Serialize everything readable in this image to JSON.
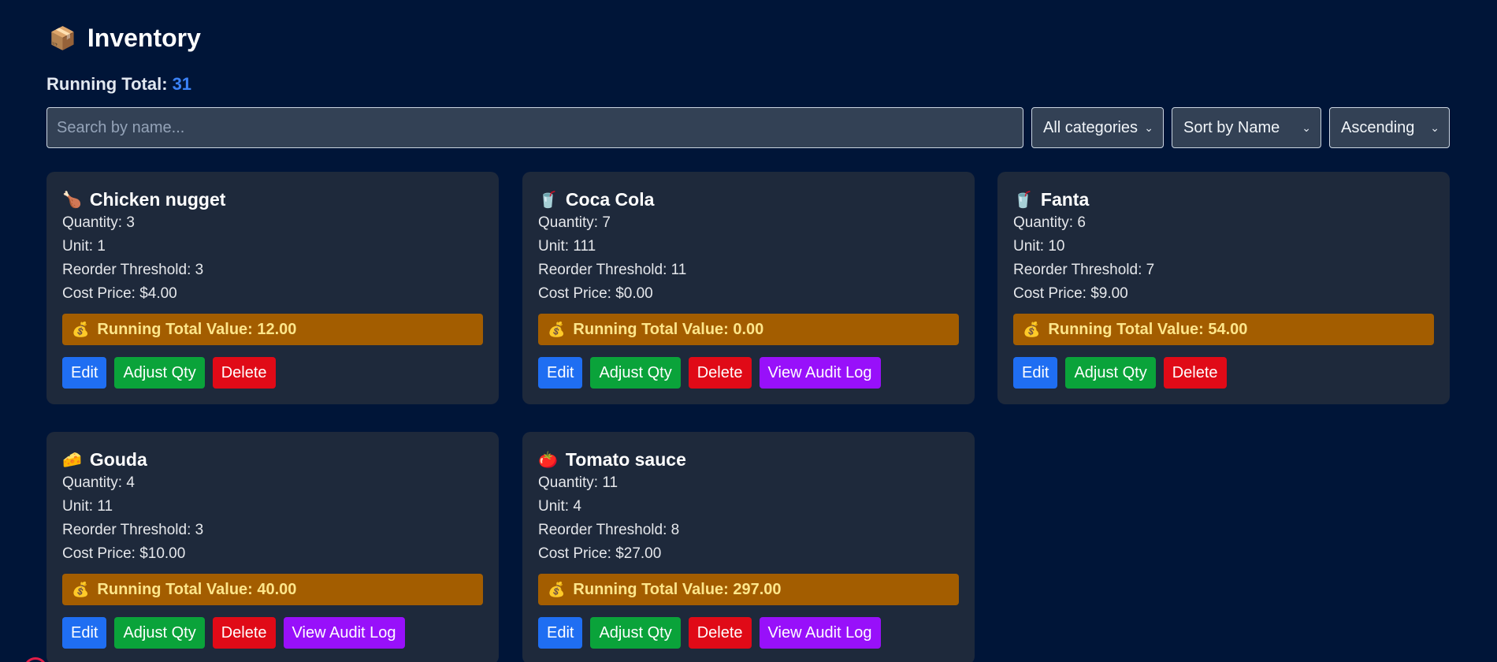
{
  "header": {
    "icon": "package-icon",
    "icon_glyph": "📦",
    "title": "Inventory"
  },
  "summary": {
    "running_total_label": "Running Total:",
    "running_total_value": "31"
  },
  "filters": {
    "search_placeholder": "Search by name...",
    "category_selected": "All categories",
    "sort_selected": "Sort by Name",
    "order_selected": "Ascending"
  },
  "buttons": {
    "edit": "Edit",
    "adjust": "Adjust Qty",
    "delete": "Delete",
    "audit": "View Audit Log"
  },
  "items": [
    {
      "emoji": "🍗",
      "icon": "chicken-icon",
      "name": "Chicken nugget",
      "quantity": "Quantity: 3",
      "unit": "Unit: 1",
      "reorder": "Reorder Threshold: 3",
      "cost": "Cost Price: $4.00",
      "value": "Running Total Value: 12.00",
      "has_audit": false
    },
    {
      "emoji": "🥤",
      "icon": "cup-icon",
      "name": "Coca Cola",
      "quantity": "Quantity: 7",
      "unit": "Unit: 111",
      "reorder": "Reorder Threshold: 11",
      "cost": "Cost Price: $0.00",
      "value": "Running Total Value: 0.00",
      "has_audit": true
    },
    {
      "emoji": "🥤",
      "icon": "cup-icon",
      "name": "Fanta",
      "quantity": "Quantity: 6",
      "unit": "Unit: 10",
      "reorder": "Reorder Threshold: 7",
      "cost": "Cost Price: $9.00",
      "value": "Running Total Value: 54.00",
      "has_audit": false
    },
    {
      "emoji": "🧀",
      "icon": "cheese-icon",
      "name": "Gouda",
      "quantity": "Quantity: 4",
      "unit": "Unit: 11",
      "reorder": "Reorder Threshold: 3",
      "cost": "Cost Price: $10.00",
      "value": "Running Total Value: 40.00",
      "has_audit": true
    },
    {
      "emoji": "🍅",
      "icon": "tomato-icon",
      "name": "Tomato sauce",
      "quantity": "Quantity: 11",
      "unit": "Unit: 4",
      "reorder": "Reorder Threshold: 8",
      "cost": "Cost Price: $27.00",
      "value": "Running Total Value: 297.00",
      "has_audit": true
    }
  ],
  "money_bag_glyph": "💰",
  "colors": {
    "background": "#001538",
    "card": "#1e293b",
    "value_bar": "#a35d00",
    "edit": "#1f6ef2",
    "adjust": "#0aa33a",
    "delete": "#e00a17",
    "audit": "#9810fa",
    "accent": "#3b82f6"
  }
}
